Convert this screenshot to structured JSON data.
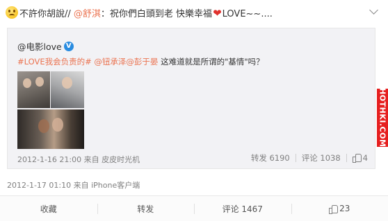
{
  "post": {
    "author_label": "不許你胡說//",
    "mention": "@舒淇",
    "text_part1": "：祝你們白頭到老 快樂幸福",
    "text_part2": "LOVE~~...."
  },
  "repost": {
    "author": "@电影love",
    "hashtag": "#LOVE我会负责的#",
    "mentions": "@钮承泽@彭于晏",
    "text": " 这难道就是所谓的\"基情\"吗？",
    "timestamp_source": "2012-1-16 21:00 来自 皮皮时光机",
    "repost_count": "转发 6190",
    "comment_count": "评论 1038",
    "like_count": "4"
  },
  "meta": {
    "timestamp_source": "2012-1-17 01:10 来自 iPhone客户端"
  },
  "actions": {
    "favorite": "收藏",
    "repost": "转发",
    "comment": "评论 1467",
    "like": "23"
  },
  "watermark": "HOTHKI.COM",
  "colors": {
    "link": "#eb7350",
    "meta": "#808080",
    "repost_bg": "#f2f2f5",
    "watermark_bg": "#e61f1f"
  }
}
